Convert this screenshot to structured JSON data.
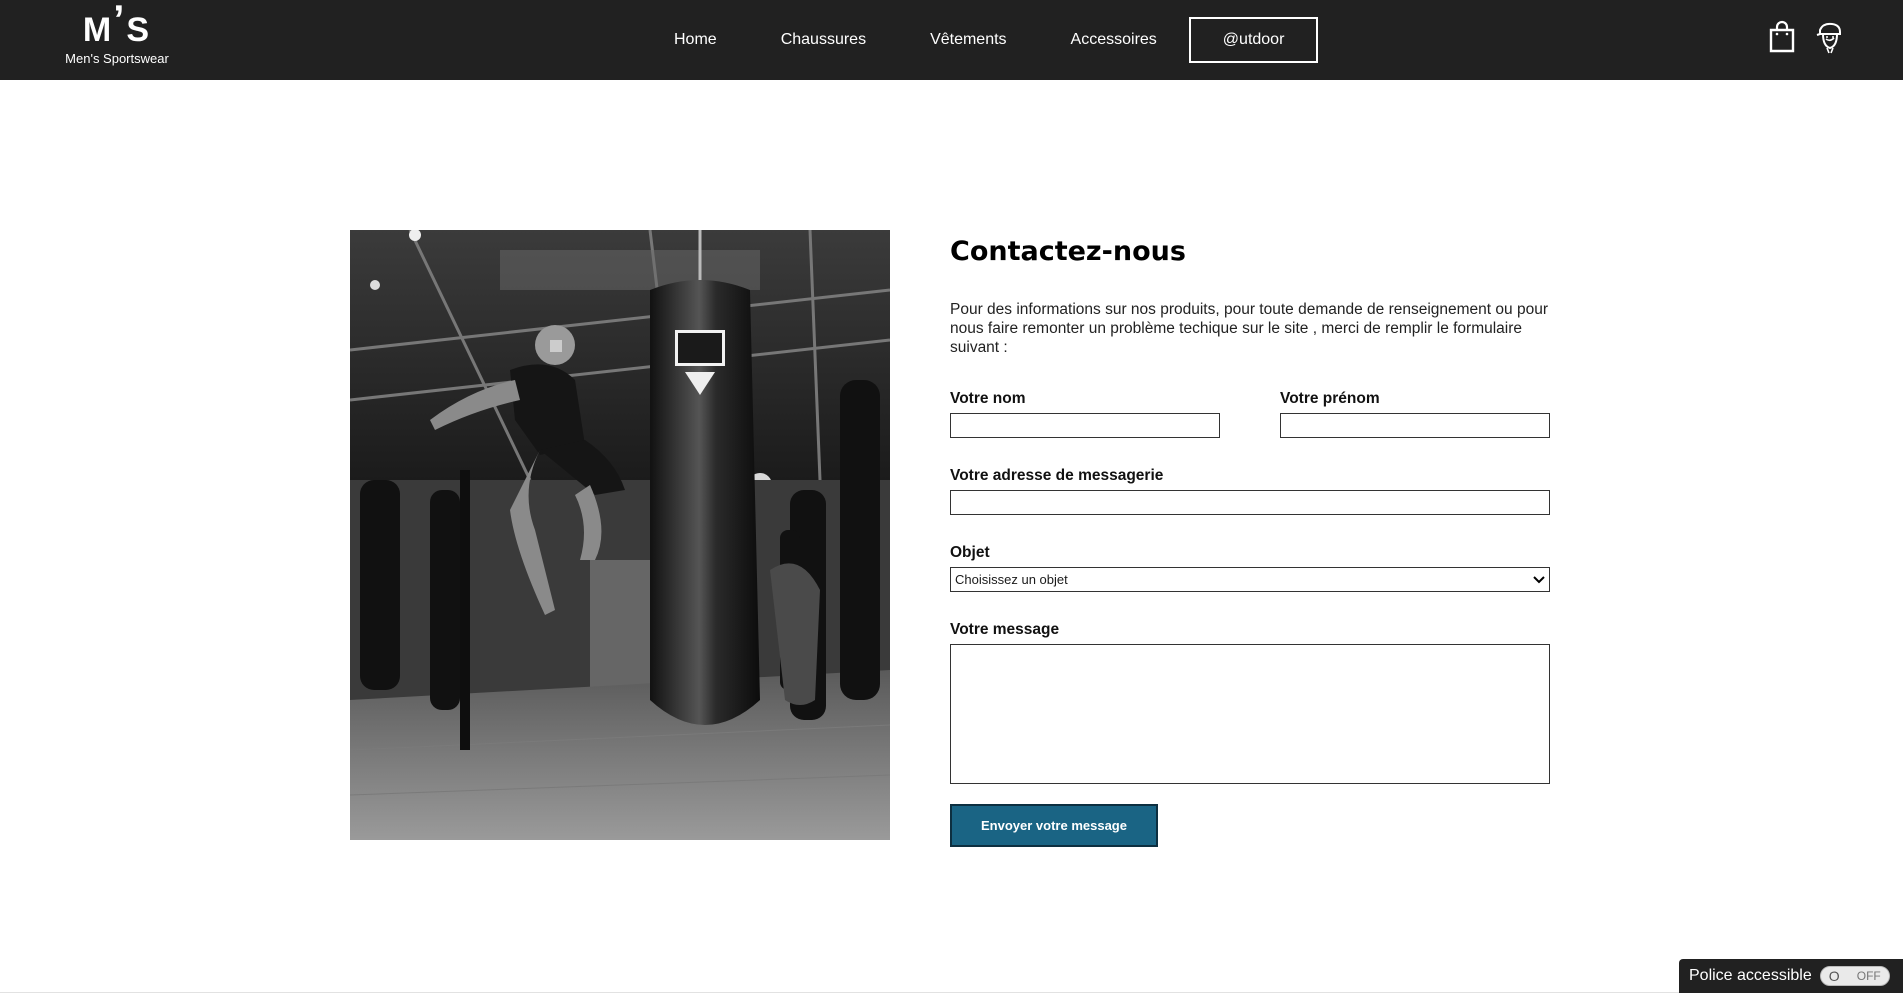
{
  "header": {
    "logo_mark": "M",
    "logo_apos": "’",
    "logo_mark2": "S",
    "logo_sub": "Men's Sportswear",
    "nav": [
      {
        "label": "Home"
      },
      {
        "label": "Chaussures"
      },
      {
        "label": "Vêtements"
      },
      {
        "label": "Accessoires"
      },
      {
        "label": "@utdoor"
      }
    ],
    "icons": [
      "shopping-bag-icon",
      "user-cap-icon"
    ]
  },
  "main": {
    "image_alt": "boxing gym photo",
    "title": "Contactez-nous",
    "intro": "Pour des informations sur nos produits, pour toute demande de renseignement ou pour nous faire remonter un problème techique sur le site , merci de remplir le formulaire suivant :",
    "form": {
      "last_name_label": "Votre nom",
      "last_name_value": "",
      "first_name_label": "Votre prénom",
      "first_name_value": "",
      "email_label": "Votre adresse de messagerie",
      "email_value": "",
      "subject_label": "Objet",
      "subject_selected": "Choisissez un objet",
      "message_label": "Votre message",
      "message_value": "",
      "submit_label": "Envoyer votre message"
    }
  },
  "a11y": {
    "label": "Police accessible",
    "toggle_knob": "O",
    "toggle_state": "OFF"
  },
  "colors": {
    "header_bg": "#212121",
    "submit_bg": "#1a6484",
    "page_bg": "#ffffff"
  }
}
